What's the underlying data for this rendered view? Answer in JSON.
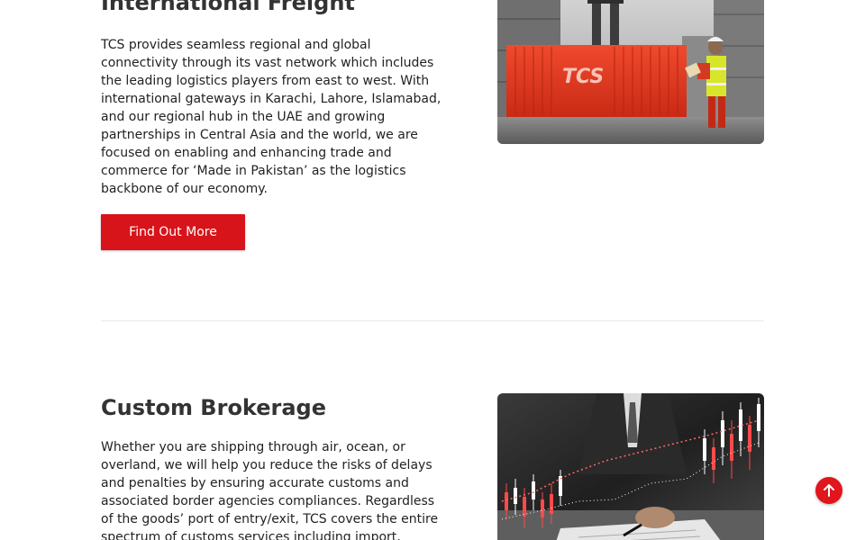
{
  "freight": {
    "title": "International Freight",
    "body": "TCS provides seamless regional and global connectivity through its vast network which includes the leading logistics players from east to west. With international gateways in Karachi, Lahore, Islamabad, and our regional hub in the UAE and growing partnerships in Central Asia and the world, we are focused on enabling and enhancing trade and commerce for ‘Made in Pakistan’ as the logistics backbone of our economy.",
    "button_label": "Find Out More",
    "image_icon": "shipping-container-photo"
  },
  "brokerage": {
    "title": "Custom Brokerage",
    "body": "Whether you are shipping through air, ocean, or overland, we will help you reduce the risks of delays and penalties by ensuring accurate customs and associated border agencies compliances. Regardless of the goods’ port of entry/exit, TCS covers the entire spectrum of customs services including import,",
    "image_icon": "stock-chart-photo"
  },
  "container_logo_text": "TCS",
  "back_to_top_icon": "arrow-up-icon",
  "colors": {
    "brand_red": "#d7141a",
    "heading": "#333333",
    "text": "#222222",
    "divider": "#e9e9e9"
  }
}
